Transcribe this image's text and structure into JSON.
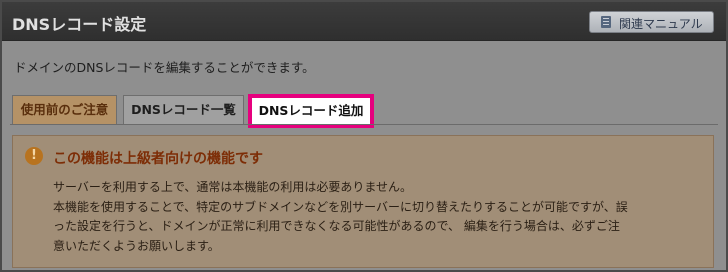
{
  "header": {
    "title": "DNSレコード設定",
    "manual_button": "関連マニュアル"
  },
  "description": "ドメインのDNSレコードを編集することができます。",
  "tabs": [
    {
      "label": "使用前のご注意",
      "state": "default"
    },
    {
      "label": "DNSレコード一覧",
      "state": "default"
    },
    {
      "label": "DNSレコード追加",
      "state": "highlighted"
    }
  ],
  "notice": {
    "icon": "exclamation-icon",
    "title": "この機能は上級者向けの機能です",
    "lines": [
      "サーバーを利用する上で、通常は本機能の利用は必要ありません。",
      "本機能を使用することで、特定のサブドメインなどを別サーバーに切り替えたりすることが可能ですが、誤",
      "った設定を行うと、ドメインが正常に利用できなくなる可能性があるので、 編集を行う場合は、必ずご注",
      "意いただくようお願いします。"
    ]
  },
  "colors": {
    "header_bg": "#333333",
    "highlight": "#e6007e",
    "notice_title": "#7d2d06"
  }
}
